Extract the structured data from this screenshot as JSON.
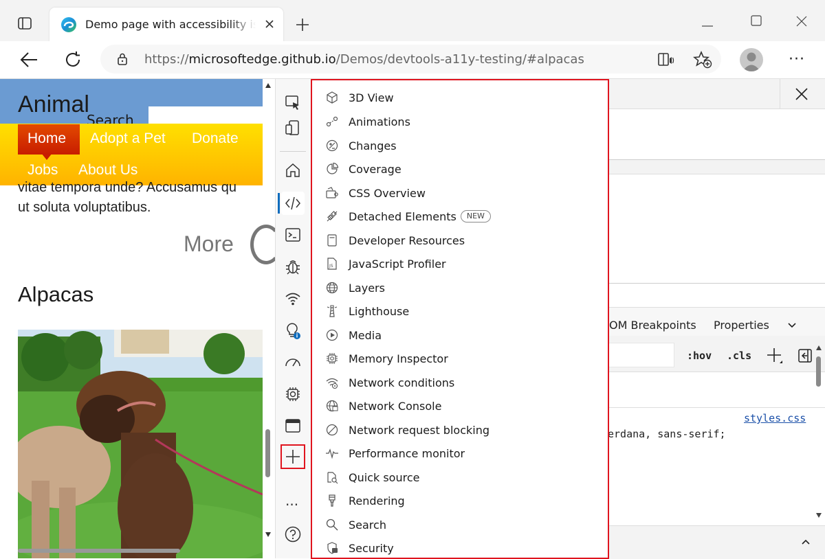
{
  "browser": {
    "tab_title": "Demo page with accessibility issues",
    "url_prefix": "https://",
    "url_host": "microsoftedge.github.io",
    "url_path": "/Demos/devtools-a11y-testing/#alpacas"
  },
  "page": {
    "site_title": "Animal",
    "search_label": "Search",
    "nav": [
      "Home",
      "Adopt a Pet",
      "Donate",
      "Jobs",
      "About Us"
    ],
    "body_text_1": "vitae tempora unde? Accusamus qu",
    "body_text_2": "ut soluta voluptatibus.",
    "more_label": "More",
    "section_heading": "Alpacas"
  },
  "devtools": {
    "menu_items": [
      {
        "label": "3D View",
        "icon": "cube-icon"
      },
      {
        "label": "Animations",
        "icon": "animations-icon"
      },
      {
        "label": "Changes",
        "icon": "changes-icon"
      },
      {
        "label": "Coverage",
        "icon": "coverage-icon"
      },
      {
        "label": "CSS Overview",
        "icon": "css-overview-icon"
      },
      {
        "label": "Detached Elements",
        "icon": "detached-elements-icon",
        "badge": "NEW"
      },
      {
        "label": "Developer Resources",
        "icon": "developer-resources-icon"
      },
      {
        "label": "JavaScript Profiler",
        "icon": "js-profiler-icon"
      },
      {
        "label": "Layers",
        "icon": "layers-icon"
      },
      {
        "label": "Lighthouse",
        "icon": "lighthouse-icon"
      },
      {
        "label": "Media",
        "icon": "media-icon"
      },
      {
        "label": "Memory Inspector",
        "icon": "memory-inspector-icon"
      },
      {
        "label": "Network conditions",
        "icon": "network-conditions-icon"
      },
      {
        "label": "Network Console",
        "icon": "network-console-icon"
      },
      {
        "label": "Network request blocking",
        "icon": "request-blocking-icon"
      },
      {
        "label": "Performance monitor",
        "icon": "performance-monitor-icon"
      },
      {
        "label": "Quick source",
        "icon": "quick-source-icon"
      },
      {
        "label": "Rendering",
        "icon": "rendering-icon"
      },
      {
        "label": "Search",
        "icon": "search-icon"
      },
      {
        "label": "Security",
        "icon": "security-icon"
      }
    ],
    "tabs_partial": [
      "OM Breakpoints",
      "Properties"
    ],
    "hov_label": ":hov",
    "cls_label": ".cls",
    "stylesheet_link": "styles.css",
    "css_fragment": "erdana, sans-serif;"
  },
  "colors": {
    "highlight_red": "#e0141e",
    "nav_gradient_top": "#ffb400",
    "nav_active": "#d62e00",
    "header_blue": "#6b9bd2"
  }
}
